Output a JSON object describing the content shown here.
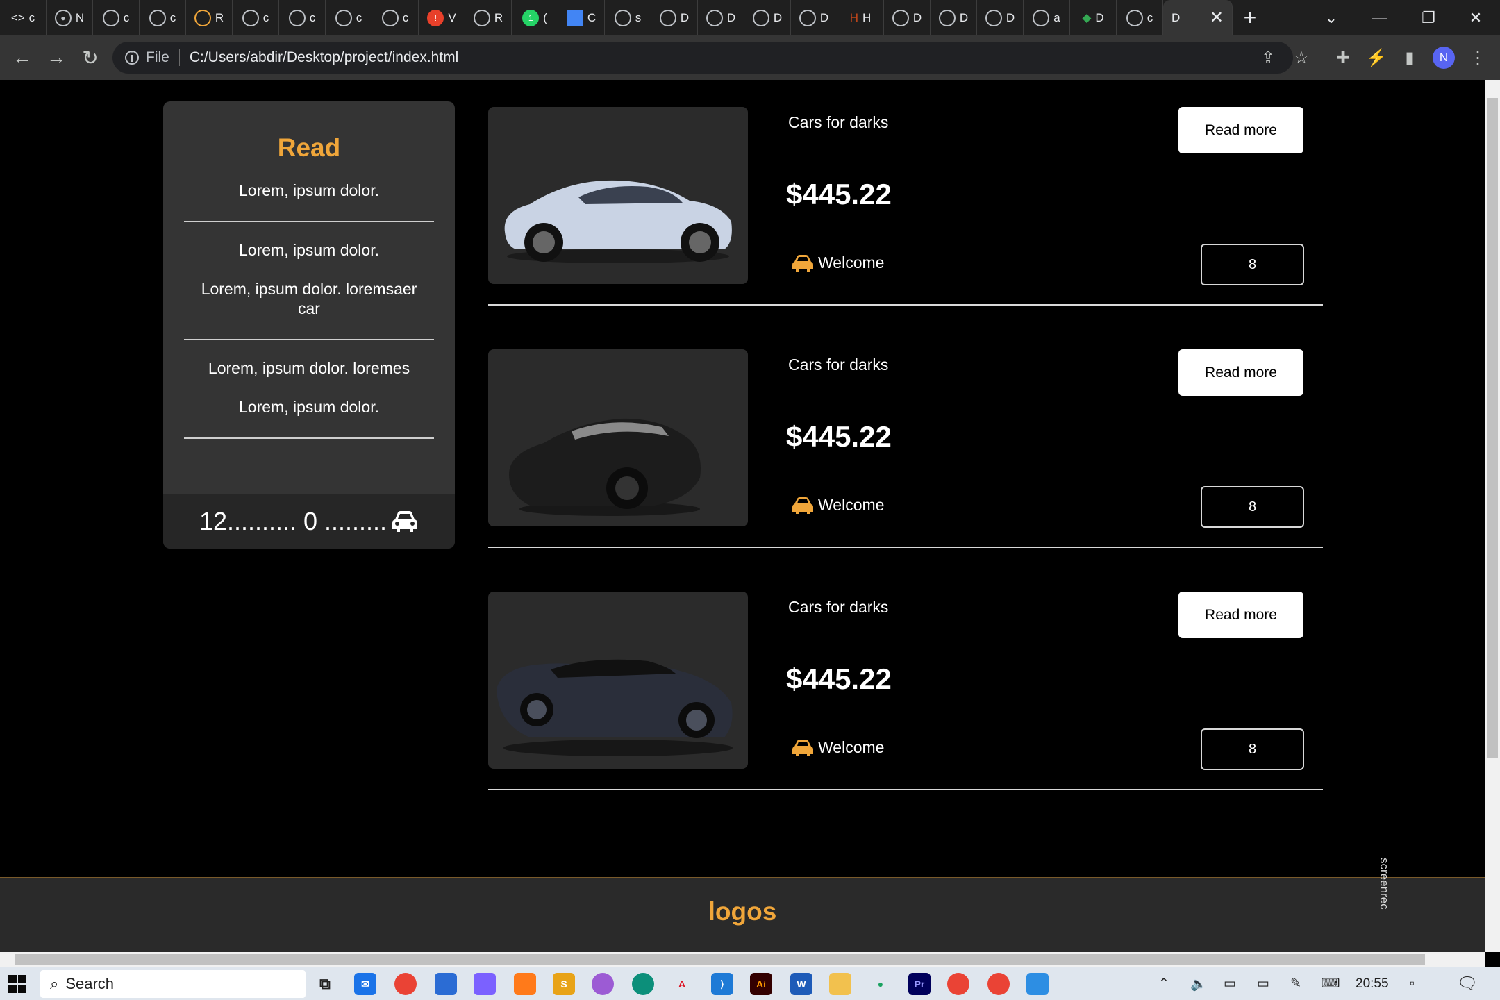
{
  "browser": {
    "tab_letters": [
      "c",
      "N",
      "c",
      "c",
      "R",
      "c",
      "c",
      "c",
      "c",
      "V",
      "R",
      "(",
      "C",
      "s",
      "D",
      "D",
      "D",
      "D",
      "H",
      "D",
      "D",
      "D",
      "a",
      "D",
      "c"
    ],
    "active_tab_letter": "D",
    "address": {
      "scheme_label": "File",
      "url": "C:/Users/abdir/Desktop/project/index.html"
    },
    "profile_initial": "N"
  },
  "sidebar": {
    "heading": "Read",
    "item1": "Lorem, ipsum dolor.",
    "item2": "Lorem, ipsum dolor.",
    "item3": "Lorem, ipsum dolor. loremsaer car",
    "item4": "Lorem, ipsum dolor. loremes",
    "item5": "Lorem, ipsum dolor.",
    "footer_text": "12.......... 0 ........."
  },
  "cards": [
    {
      "title": "Cars for darks",
      "price": "$445.22",
      "welcome": "Welcome",
      "button": "Read more",
      "count": "8",
      "car_color": "#c9d3e4"
    },
    {
      "title": "Cars for darks",
      "price": "$445.22",
      "welcome": "Welcome",
      "button": "Read more",
      "count": "8",
      "car_color": "#1c1c1c"
    },
    {
      "title": "Cars for darks",
      "price": "$445.22",
      "welcome": "Welcome",
      "button": "Read more",
      "count": "8",
      "car_color": "#2a2e3a"
    }
  ],
  "footer": {
    "heading": "logos",
    "watermark": "screenrec"
  },
  "taskbar": {
    "search_placeholder": "Search",
    "clock": "20:55"
  },
  "colors": {
    "accent": "#f0a63a",
    "page_bg": "#000000",
    "panel_bg": "#343434"
  }
}
